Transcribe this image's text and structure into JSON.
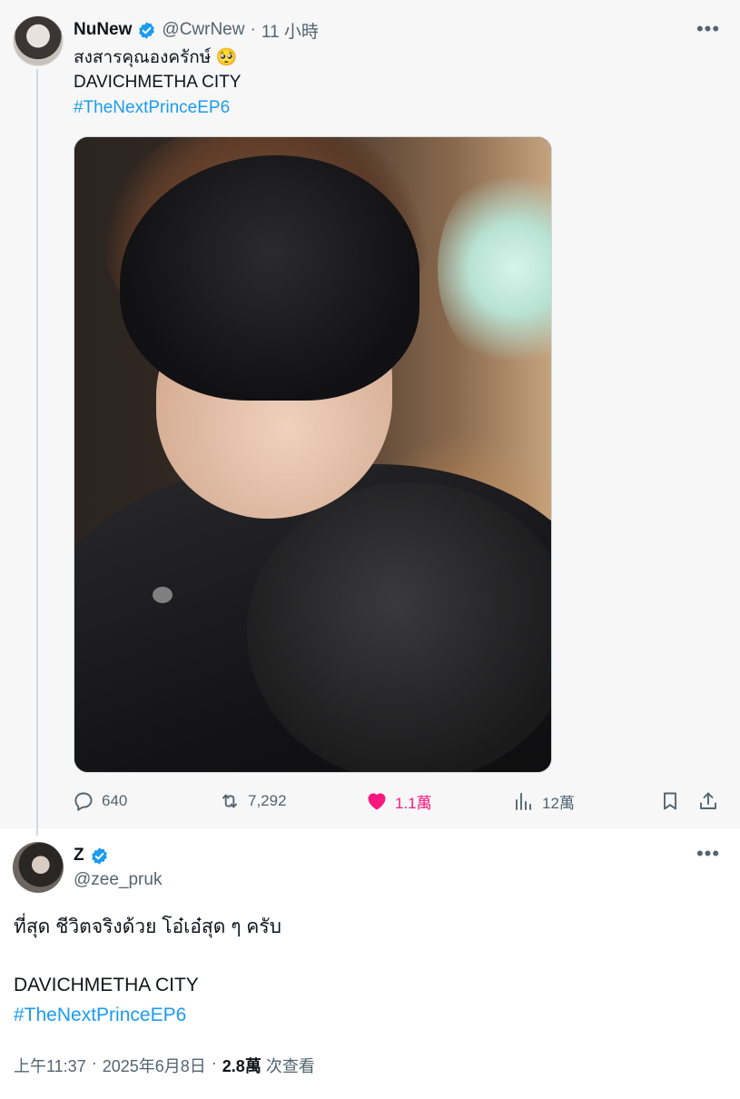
{
  "quoted_tweet": {
    "display_name": "NuNew",
    "handle": "@CwrNew",
    "dot": "·",
    "time_ago": "11 小時",
    "lines": [
      "สงสารคุณองครักษ์ 🥺",
      "DAVICHMETHA CITY"
    ],
    "hashtag": "#TheNextPrinceEP6",
    "actions": {
      "replies": "640",
      "retweets": "7,292",
      "likes": "1.1萬",
      "views": "12萬"
    },
    "liked": true
  },
  "main_tweet": {
    "display_name": "Z",
    "handle": "@zee_pruk",
    "lines": [
      "ที่สุด ชีวิตจริงด้วย โอ๋เอ๋สุด ๆ ครับ",
      "DAVICHMETHA CITY"
    ],
    "hashtag": "#TheNextPrinceEP6",
    "time": "上午11:37",
    "date": "2025年6月8日",
    "separator": "·",
    "views_count": "2.8萬",
    "views_label": "次查看"
  },
  "icons": {
    "verified": "verified-badge-icon",
    "more": "more-options-icon",
    "reply": "reply-icon",
    "retweet": "retweet-icon",
    "like": "heart-icon",
    "views": "analytics-icon",
    "bookmark": "bookmark-icon",
    "share": "share-icon"
  },
  "colors": {
    "accent": "#1d9bf0",
    "like": "#f91880",
    "muted": "#536471",
    "quoted_bg": "#f7f7f7"
  }
}
